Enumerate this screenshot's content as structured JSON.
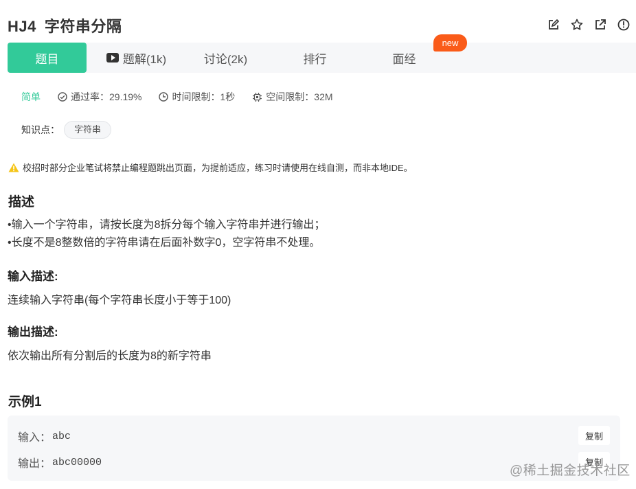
{
  "problem": {
    "code": "HJ4",
    "title": "字符串分隔"
  },
  "header_icons": [
    "edit-icon",
    "star-icon",
    "external-link-icon",
    "info-icon"
  ],
  "tabs": [
    {
      "label": "题目",
      "active": true
    },
    {
      "label": "题解(1k)",
      "icon": "video-icon"
    },
    {
      "label": "讨论(2k)"
    },
    {
      "label": "排行"
    },
    {
      "label": "面经",
      "badge": "new"
    }
  ],
  "meta": {
    "difficulty": "简单",
    "pass_rate": "通过率：29.19%",
    "time_limit": "时间限制：1秒",
    "space_limit": "空间限制：32M"
  },
  "knowledge": {
    "label": "知识点：",
    "tag": "字符串"
  },
  "warning": "校招时部分企业笔试将禁止编程题跳出页面，为提前适应，练习时请使用在线自测，而非本地IDE。",
  "description": {
    "heading": "描述",
    "lines": [
      "•输入一个字符串，请按长度为8拆分每个输入字符串并进行输出；",
      "•长度不是8整数倍的字符串请在后面补数字0，空字符串不处理。"
    ]
  },
  "input_desc": {
    "heading": "输入描述:",
    "text": "连续输入字符串(每个字符串长度小于等于100)"
  },
  "output_desc": {
    "heading": "输出描述:",
    "text": "依次输出所有分割后的长度为8的新字符串"
  },
  "example": {
    "heading": "示例1",
    "input_label": "输入：",
    "input_value": "abc",
    "output_label": "输出：",
    "output_value": "abc00000",
    "copy_label": "复制"
  },
  "watermark": "@稀土掘金技术社区",
  "colors": {
    "accent": "#32ca99",
    "badge": "#fa5b19",
    "warning": "#f5c518"
  }
}
